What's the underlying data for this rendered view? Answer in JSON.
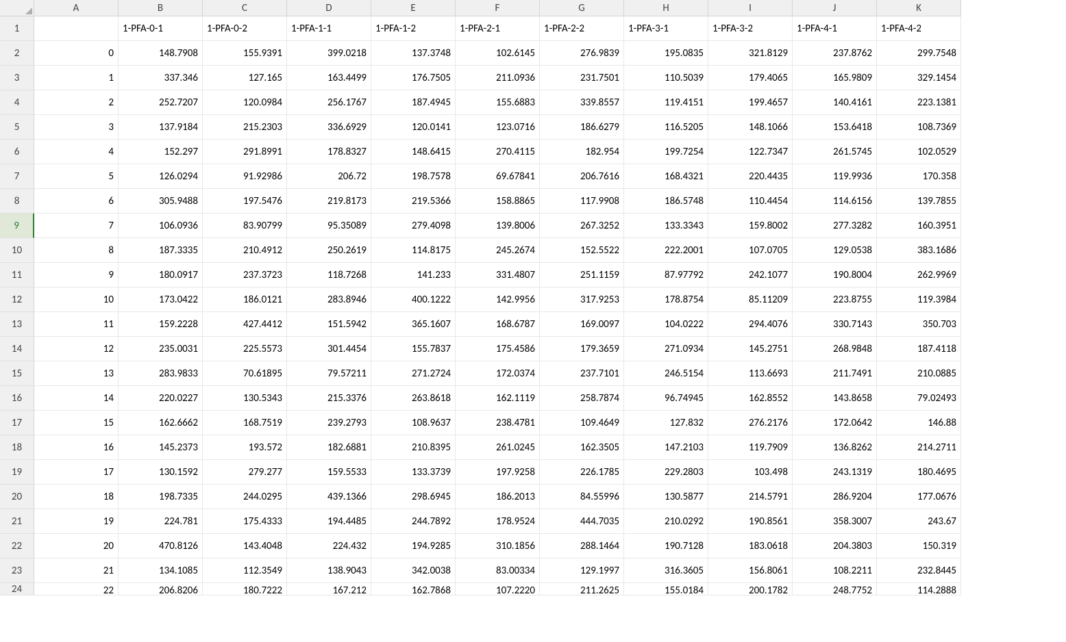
{
  "columns": [
    "A",
    "B",
    "C",
    "D",
    "E",
    "F",
    "G",
    "H",
    "I",
    "J",
    "K"
  ],
  "selectedRow": 9,
  "rows": [
    {
      "num": "1",
      "cells": [
        "",
        "1-PFA-0-1",
        "1-PFA-0-2",
        "1-PFA-1-1",
        "1-PFA-1-2",
        "1-PFA-2-1",
        "1-PFA-2-2",
        "1-PFA-3-1",
        "1-PFA-3-2",
        "1-PFA-4-1",
        "1-PFA-4-2"
      ],
      "types": [
        "text",
        "text",
        "text",
        "text",
        "text",
        "text",
        "text",
        "text",
        "text",
        "text",
        "text"
      ]
    },
    {
      "num": "2",
      "cells": [
        "0",
        "148.7908",
        "155.9391",
        "399.0218",
        "137.3748",
        "102.6145",
        "276.9839",
        "195.0835",
        "321.8129",
        "237.8762",
        "299.7548"
      ],
      "types": [
        "num",
        "num",
        "num",
        "num",
        "num",
        "num",
        "num",
        "num",
        "num",
        "num",
        "num"
      ]
    },
    {
      "num": "3",
      "cells": [
        "1",
        "337.346",
        "127.165",
        "163.4499",
        "176.7505",
        "211.0936",
        "231.7501",
        "110.5039",
        "179.4065",
        "165.9809",
        "329.1454"
      ],
      "types": [
        "num",
        "num",
        "num",
        "num",
        "num",
        "num",
        "num",
        "num",
        "num",
        "num",
        "num"
      ]
    },
    {
      "num": "4",
      "cells": [
        "2",
        "252.7207",
        "120.0984",
        "256.1767",
        "187.4945",
        "155.6883",
        "339.8557",
        "119.4151",
        "199.4657",
        "140.4161",
        "223.1381"
      ],
      "types": [
        "num",
        "num",
        "num",
        "num",
        "num",
        "num",
        "num",
        "num",
        "num",
        "num",
        "num"
      ]
    },
    {
      "num": "5",
      "cells": [
        "3",
        "137.9184",
        "215.2303",
        "336.6929",
        "120.0141",
        "123.0716",
        "186.6279",
        "116.5205",
        "148.1066",
        "153.6418",
        "108.7369"
      ],
      "types": [
        "num",
        "num",
        "num",
        "num",
        "num",
        "num",
        "num",
        "num",
        "num",
        "num",
        "num"
      ]
    },
    {
      "num": "6",
      "cells": [
        "4",
        "152.297",
        "291.8991",
        "178.8327",
        "148.6415",
        "270.4115",
        "182.954",
        "199.7254",
        "122.7347",
        "261.5745",
        "102.0529"
      ],
      "types": [
        "num",
        "num",
        "num",
        "num",
        "num",
        "num",
        "num",
        "num",
        "num",
        "num",
        "num"
      ]
    },
    {
      "num": "7",
      "cells": [
        "5",
        "126.0294",
        "91.92986",
        "206.72",
        "198.7578",
        "69.67841",
        "206.7616",
        "168.4321",
        "220.4435",
        "119.9936",
        "170.358"
      ],
      "types": [
        "num",
        "num",
        "num",
        "num",
        "num",
        "num",
        "num",
        "num",
        "num",
        "num",
        "num"
      ]
    },
    {
      "num": "8",
      "cells": [
        "6",
        "305.9488",
        "197.5476",
        "219.8173",
        "219.5366",
        "158.8865",
        "117.9908",
        "186.5748",
        "110.4454",
        "114.6156",
        "139.7855"
      ],
      "types": [
        "num",
        "num",
        "num",
        "num",
        "num",
        "num",
        "num",
        "num",
        "num",
        "num",
        "num"
      ]
    },
    {
      "num": "9",
      "cells": [
        "7",
        "106.0936",
        "83.90799",
        "95.35089",
        "279.4098",
        "139.8006",
        "267.3252",
        "133.3343",
        "159.8002",
        "277.3282",
        "160.3951"
      ],
      "types": [
        "num",
        "num",
        "num",
        "num",
        "num",
        "num",
        "num",
        "num",
        "num",
        "num",
        "num"
      ]
    },
    {
      "num": "10",
      "cells": [
        "8",
        "187.3335",
        "210.4912",
        "250.2619",
        "114.8175",
        "245.2674",
        "152.5522",
        "222.2001",
        "107.0705",
        "129.0538",
        "383.1686"
      ],
      "types": [
        "num",
        "num",
        "num",
        "num",
        "num",
        "num",
        "num",
        "num",
        "num",
        "num",
        "num"
      ]
    },
    {
      "num": "11",
      "cells": [
        "9",
        "180.0917",
        "237.3723",
        "118.7268",
        "141.233",
        "331.4807",
        "251.1159",
        "87.97792",
        "242.1077",
        "190.8004",
        "262.9969"
      ],
      "types": [
        "num",
        "num",
        "num",
        "num",
        "num",
        "num",
        "num",
        "num",
        "num",
        "num",
        "num"
      ]
    },
    {
      "num": "12",
      "cells": [
        "10",
        "173.0422",
        "186.0121",
        "283.8946",
        "400.1222",
        "142.9956",
        "317.9253",
        "178.8754",
        "85.11209",
        "223.8755",
        "119.3984"
      ],
      "types": [
        "num",
        "num",
        "num",
        "num",
        "num",
        "num",
        "num",
        "num",
        "num",
        "num",
        "num"
      ]
    },
    {
      "num": "13",
      "cells": [
        "11",
        "159.2228",
        "427.4412",
        "151.5942",
        "365.1607",
        "168.6787",
        "169.0097",
        "104.0222",
        "294.4076",
        "330.7143",
        "350.703"
      ],
      "types": [
        "num",
        "num",
        "num",
        "num",
        "num",
        "num",
        "num",
        "num",
        "num",
        "num",
        "num"
      ]
    },
    {
      "num": "14",
      "cells": [
        "12",
        "235.0031",
        "225.5573",
        "301.4454",
        "155.7837",
        "175.4586",
        "179.3659",
        "271.0934",
        "145.2751",
        "268.9848",
        "187.4118"
      ],
      "types": [
        "num",
        "num",
        "num",
        "num",
        "num",
        "num",
        "num",
        "num",
        "num",
        "num",
        "num"
      ]
    },
    {
      "num": "15",
      "cells": [
        "13",
        "283.9833",
        "70.61895",
        "79.57211",
        "271.2724",
        "172.0374",
        "237.7101",
        "246.5154",
        "113.6693",
        "211.7491",
        "210.0885"
      ],
      "types": [
        "num",
        "num",
        "num",
        "num",
        "num",
        "num",
        "num",
        "num",
        "num",
        "num",
        "num"
      ]
    },
    {
      "num": "16",
      "cells": [
        "14",
        "220.0227",
        "130.5343",
        "215.3376",
        "263.8618",
        "162.1119",
        "258.7874",
        "96.74945",
        "162.8552",
        "143.8658",
        "79.02493"
      ],
      "types": [
        "num",
        "num",
        "num",
        "num",
        "num",
        "num",
        "num",
        "num",
        "num",
        "num",
        "num"
      ]
    },
    {
      "num": "17",
      "cells": [
        "15",
        "162.6662",
        "168.7519",
        "239.2793",
        "108.9637",
        "238.4781",
        "109.4649",
        "127.832",
        "276.2176",
        "172.0642",
        "146.88"
      ],
      "types": [
        "num",
        "num",
        "num",
        "num",
        "num",
        "num",
        "num",
        "num",
        "num",
        "num",
        "num"
      ]
    },
    {
      "num": "18",
      "cells": [
        "16",
        "145.2373",
        "193.572",
        "182.6881",
        "210.8395",
        "261.0245",
        "162.3505",
        "147.2103",
        "119.7909",
        "136.8262",
        "214.2711"
      ],
      "types": [
        "num",
        "num",
        "num",
        "num",
        "num",
        "num",
        "num",
        "num",
        "num",
        "num",
        "num"
      ]
    },
    {
      "num": "19",
      "cells": [
        "17",
        "130.1592",
        "279.277",
        "159.5533",
        "133.3739",
        "197.9258",
        "226.1785",
        "229.2803",
        "103.498",
        "243.1319",
        "180.4695"
      ],
      "types": [
        "num",
        "num",
        "num",
        "num",
        "num",
        "num",
        "num",
        "num",
        "num",
        "num",
        "num"
      ]
    },
    {
      "num": "20",
      "cells": [
        "18",
        "198.7335",
        "244.0295",
        "439.1366",
        "298.6945",
        "186.2013",
        "84.55996",
        "130.5877",
        "214.5791",
        "286.9204",
        "177.0676"
      ],
      "types": [
        "num",
        "num",
        "num",
        "num",
        "num",
        "num",
        "num",
        "num",
        "num",
        "num",
        "num"
      ]
    },
    {
      "num": "21",
      "cells": [
        "19",
        "224.781",
        "175.4333",
        "194.4485",
        "244.7892",
        "178.9524",
        "444.7035",
        "210.0292",
        "190.8561",
        "358.3007",
        "243.67"
      ],
      "types": [
        "num",
        "num",
        "num",
        "num",
        "num",
        "num",
        "num",
        "num",
        "num",
        "num",
        "num"
      ]
    },
    {
      "num": "22",
      "cells": [
        "20",
        "470.8126",
        "143.4048",
        "224.432",
        "194.9285",
        "310.1856",
        "288.1464",
        "190.7128",
        "183.0618",
        "204.3803",
        "150.319"
      ],
      "types": [
        "num",
        "num",
        "num",
        "num",
        "num",
        "num",
        "num",
        "num",
        "num",
        "num",
        "num"
      ]
    },
    {
      "num": "23",
      "cells": [
        "21",
        "134.1085",
        "112.3549",
        "138.9043",
        "342.0038",
        "83.00334",
        "129.1997",
        "316.3605",
        "156.8061",
        "108.2211",
        "232.8445"
      ],
      "types": [
        "num",
        "num",
        "num",
        "num",
        "num",
        "num",
        "num",
        "num",
        "num",
        "num",
        "num"
      ]
    },
    {
      "num": "24",
      "cells": [
        "22",
        "206.8206",
        "180.7222",
        "167.212",
        "162.7868",
        "107.2220",
        "211.2625",
        "155.0184",
        "200.1782",
        "248.7752",
        "114.2888"
      ],
      "types": [
        "num",
        "num",
        "num",
        "num",
        "num",
        "num",
        "num",
        "num",
        "num",
        "num",
        "num"
      ],
      "partial": true
    }
  ]
}
